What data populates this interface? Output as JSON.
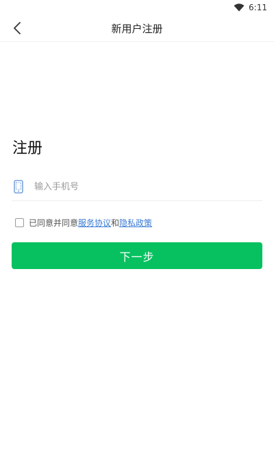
{
  "status_bar": {
    "time": "6:11",
    "icons": [
      "wifi-icon"
    ]
  },
  "nav": {
    "back_icon": "chevron-left-icon",
    "title": "新用户注册"
  },
  "main": {
    "heading": "注册",
    "phone_field": {
      "icon": "phone-icon",
      "placeholder": "输入手机号",
      "value": ""
    },
    "agreement": {
      "checked": false,
      "prefix": "已同意并同意",
      "link_service": "服务协议",
      "conjunction": "和",
      "link_privacy": "隐私政策"
    },
    "next_button_label": "下一步"
  },
  "colors": {
    "primary": "#07c160",
    "link": "#3a7bd5",
    "placeholder": "#9a9a9a",
    "phone_icon": "#5b8fd6"
  }
}
